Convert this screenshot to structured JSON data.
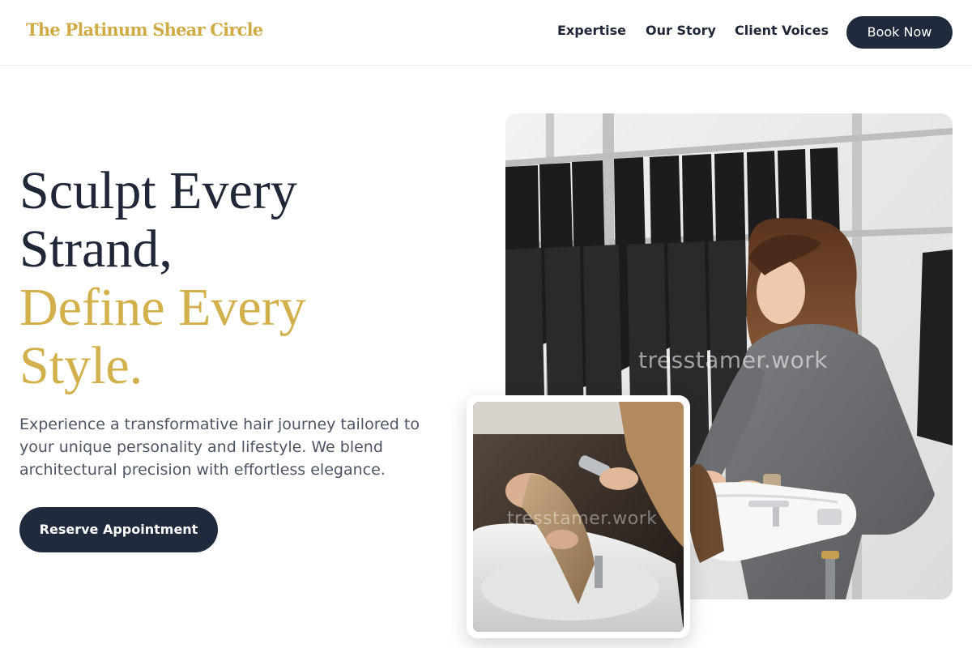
{
  "brand": {
    "name": "The Platinum Shear Circle",
    "color": "#cfab45"
  },
  "nav": {
    "links": [
      {
        "label": "Expertise"
      },
      {
        "label": "Our Story"
      },
      {
        "label": "Client Voices"
      }
    ],
    "cta_label": "Book Now"
  },
  "hero": {
    "title_lines": [
      {
        "text": "Sculpt Every",
        "tone": "dark"
      },
      {
        "text": "Strand,",
        "tone": "dark"
      },
      {
        "text": "Define Every",
        "tone": "gold"
      },
      {
        "text": "Style.",
        "tone": "gold"
      }
    ],
    "subtitle": "Experience a transformative hair journey tailored to your unique personality and lifestyle. We blend architectural precision with effortless elegance.",
    "cta_label": "Reserve Appointment"
  },
  "images": {
    "main": {
      "description_icon": "stylist-at-wash-basin-photo",
      "watermark": "tresstamer.work"
    },
    "inset": {
      "description_icon": "client-hair-wash-photo",
      "watermark": "tresstamer.work"
    }
  },
  "colors": {
    "navy": "#1f2a3d",
    "gold": "#d2b04c",
    "text_dark": "#1f2739",
    "text_muted": "#4d5563"
  }
}
